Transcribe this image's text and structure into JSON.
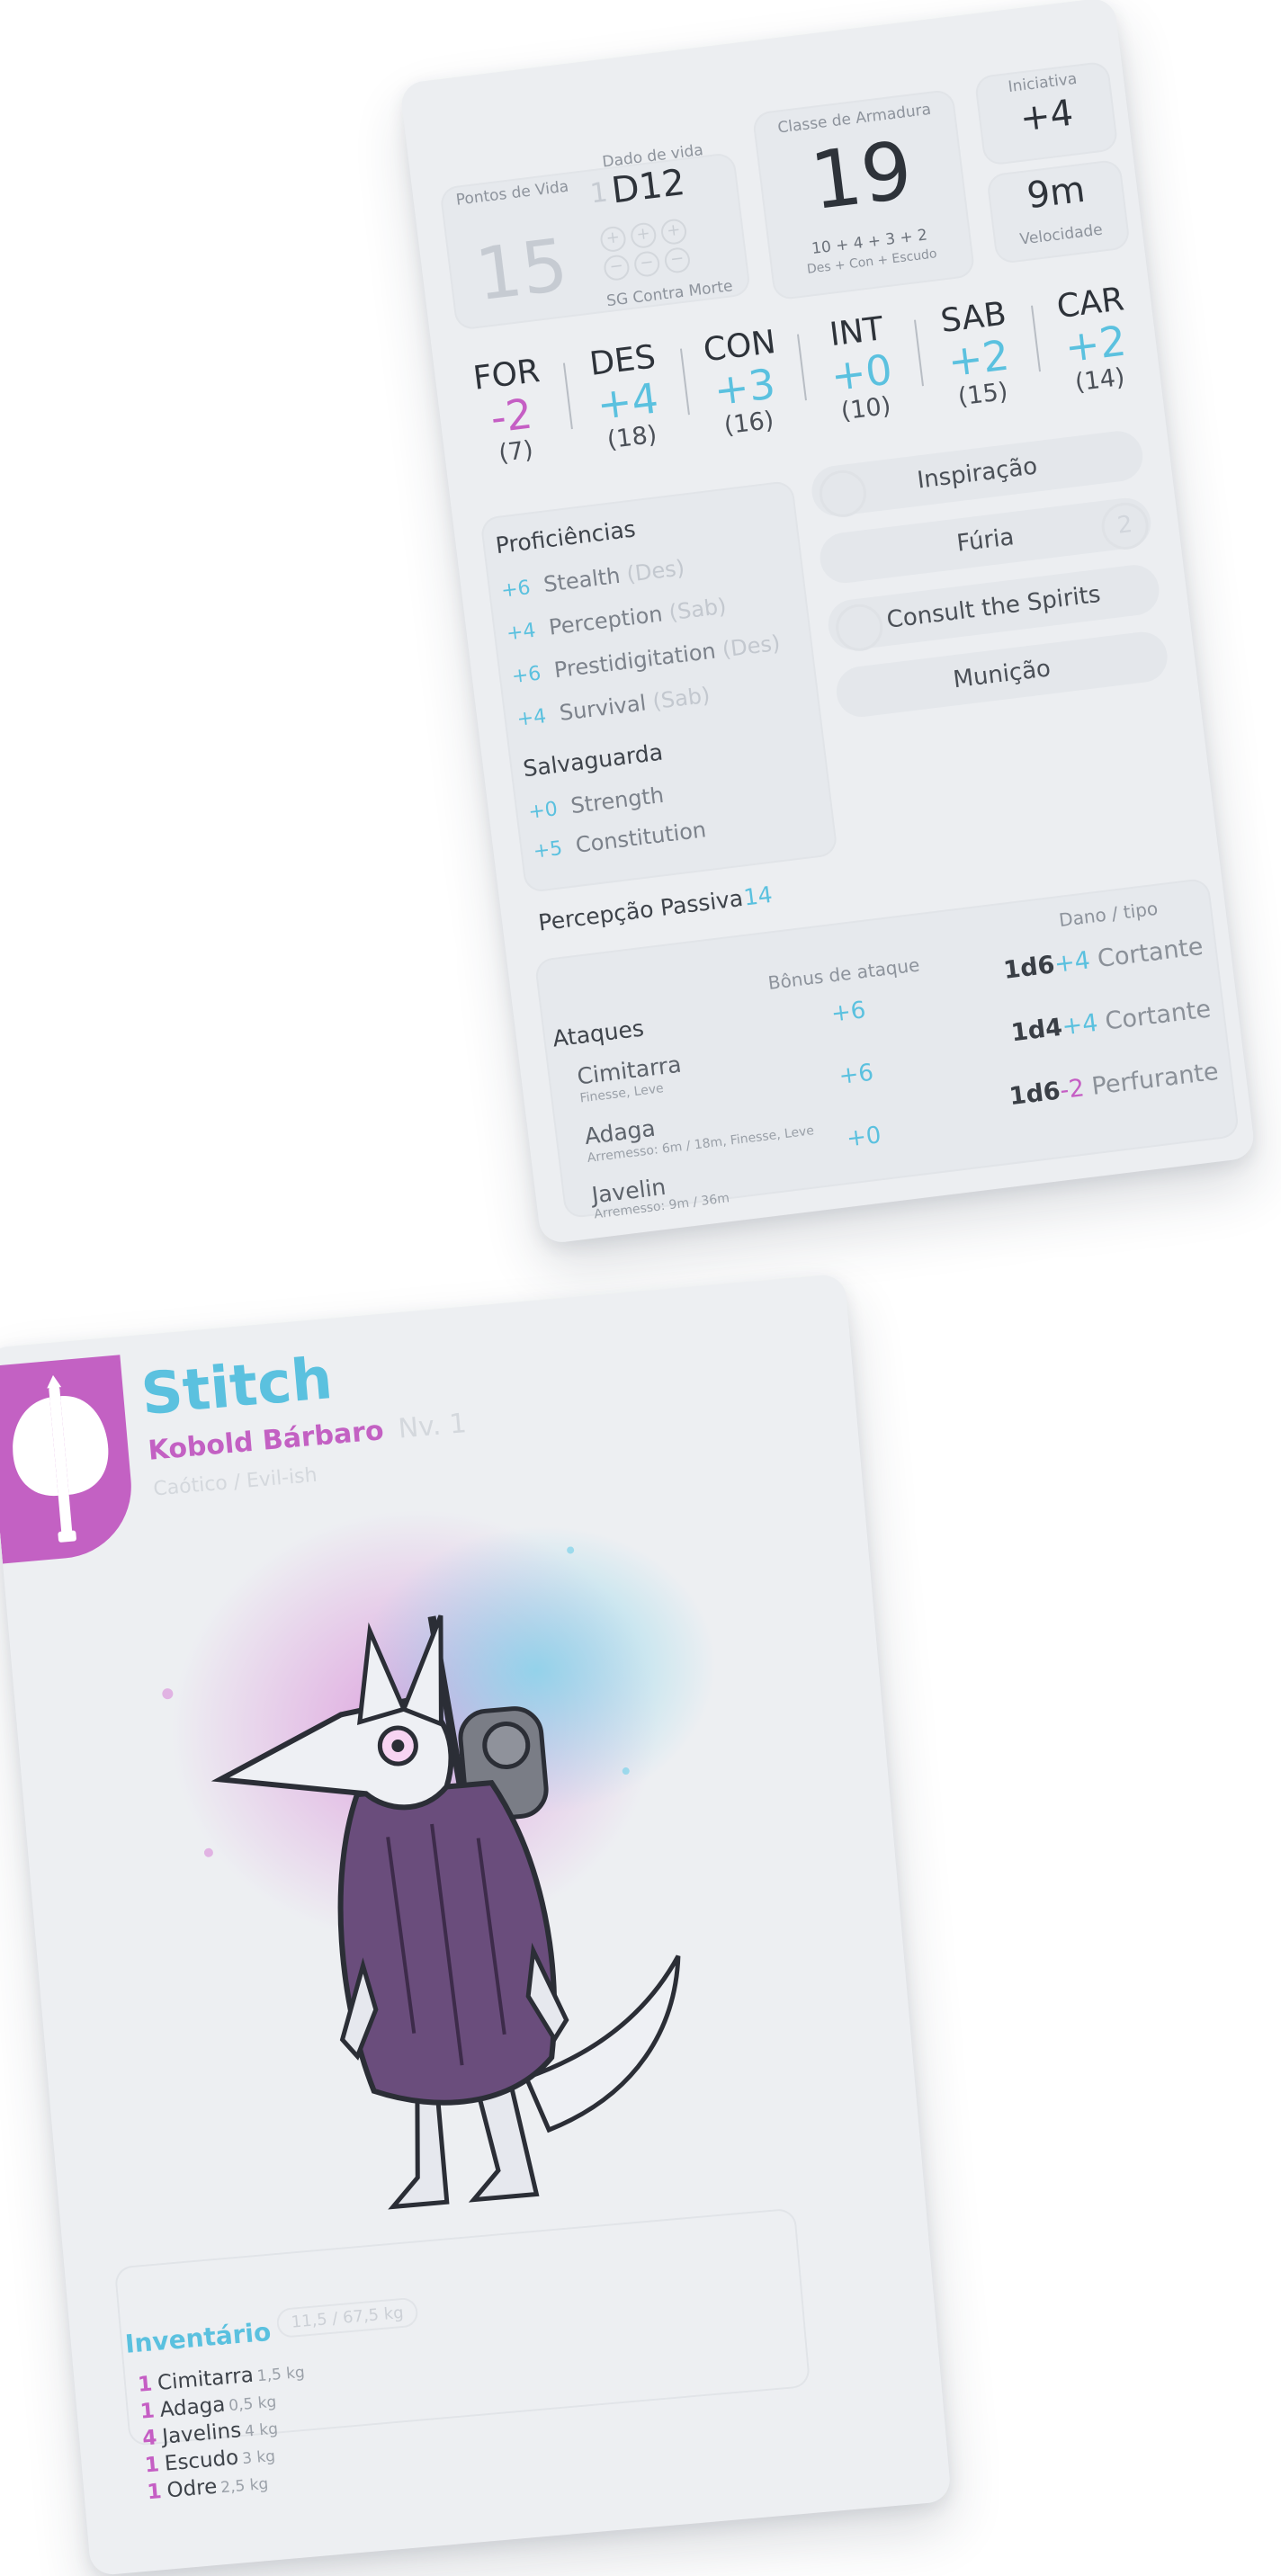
{
  "sheet": {
    "pontos_de_vida": {
      "label": "Pontos de Vida",
      "value": "15"
    },
    "dado_de_vida": {
      "label": "Dado de vida",
      "count": "1",
      "die": "D12"
    },
    "sg_contra_morte": "SG Contra Morte",
    "classe_armadura": {
      "label": "Classe de Armadura",
      "value": "19",
      "formula": "10 + 4 + 3 + 2",
      "formula_sub": "Des + Con + Escudo"
    },
    "iniciativa": {
      "label": "Iniciativa",
      "value": "+4"
    },
    "velocidade": {
      "label": "Velocidade",
      "value": "9m"
    },
    "stats": [
      {
        "ab": "FOR",
        "mod": "-2",
        "score": "(7)",
        "color": "#c55ec4"
      },
      {
        "ab": "DES",
        "mod": "+4",
        "score": "(18)",
        "color": "#5bc1df"
      },
      {
        "ab": "CON",
        "mod": "+3",
        "score": "(16)",
        "color": "#5bc1df"
      },
      {
        "ab": "INT",
        "mod": "+0",
        "score": "(10)",
        "color": "#5bc1df"
      },
      {
        "ab": "SAB",
        "mod": "+2",
        "score": "(15)",
        "color": "#5bc1df"
      },
      {
        "ab": "CAR",
        "mod": "+2",
        "score": "(14)",
        "color": "#5bc1df"
      }
    ],
    "proficiencias": {
      "title": "Proficiências",
      "items": [
        {
          "v": "+6",
          "name": "Stealth",
          "attr": "(Des)"
        },
        {
          "v": "+4",
          "name": "Perception",
          "attr": "(Sab)"
        },
        {
          "v": "+6",
          "name": "Prestidigitation",
          "attr": "(Des)"
        },
        {
          "v": "+4",
          "name": "Survival",
          "attr": "(Sab)"
        }
      ]
    },
    "salvaguarda": {
      "title": "Salvaguarda",
      "items": [
        {
          "v": "+0",
          "name": "Strength"
        },
        {
          "v": "+5",
          "name": "Constitution"
        }
      ]
    },
    "percepcao_passiva": {
      "label": "Percepção Passiva",
      "value": "14"
    },
    "features": {
      "inspiracao": "Inspiração",
      "furia": {
        "label": "Fúria",
        "count": "2"
      },
      "consult": "Consult the Spirits",
      "municao": "Munição"
    },
    "ataques": {
      "title": "Ataques",
      "bonus_header": "Bônus de ataque",
      "dano_header": "Dano / tipo",
      "items": [
        {
          "name": "Cimitarra",
          "props": "Finesse, Leve",
          "bonus": "+6",
          "dice": "1d6",
          "mod": "+4",
          "type": "Cortante",
          "modcolor": "#5bc1df"
        },
        {
          "name": "Adaga",
          "props": "Arremesso: 6m / 18m, Finesse, Leve",
          "bonus": "+6",
          "dice": "1d4",
          "mod": "+4",
          "type": "Cortante",
          "modcolor": "#5bc1df"
        },
        {
          "name": "Javelin",
          "props": "Arremesso: 9m / 36m",
          "bonus": "+0",
          "dice": "1d6",
          "mod": "-2",
          "type": "Perfurante",
          "modcolor": "#c55ec4"
        }
      ]
    }
  },
  "character": {
    "name": "Stitch",
    "race_class": "Kobold Bárbaro",
    "level": "Nv. 1",
    "alignment": "Caótico / Evil-ish",
    "colors": {
      "pink": "#c361c3",
      "teal": "#5bc1df",
      "cloak": "#6a4d7c"
    },
    "icon": "battle-axe-icon",
    "inventory": {
      "title": "Inventário",
      "weight": "11,5 / 67,5 kg",
      "items": [
        {
          "q": "1",
          "name": "Cimitarra",
          "w": "1,5 kg"
        },
        {
          "q": "1",
          "name": "Adaga",
          "w": "0,5 kg"
        },
        {
          "q": "4",
          "name": "Javelins",
          "w": "4 kg"
        },
        {
          "q": "1",
          "name": "Escudo",
          "w": "3 kg"
        },
        {
          "q": "1",
          "name": "Odre",
          "w": "2,5 kg"
        }
      ]
    }
  }
}
